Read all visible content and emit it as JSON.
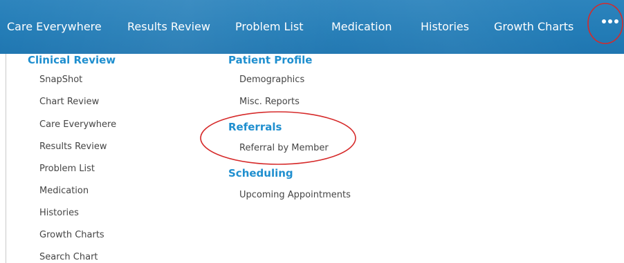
{
  "nav": {
    "items": [
      {
        "label": "Care Everywhere"
      },
      {
        "label": "Results Review"
      },
      {
        "label": "Problem List"
      },
      {
        "label": "Medication"
      },
      {
        "label": "Histories"
      },
      {
        "label": "Growth Charts"
      }
    ],
    "more_icon": "more-dots-icon"
  },
  "menu": {
    "clinical_review": {
      "heading": "Clinical Review",
      "items": [
        "SnapShot",
        "Chart Review",
        "Care Everywhere",
        "Results Review",
        "Problem List",
        "Medication",
        "Histories",
        "Growth Charts",
        "Search Chart"
      ]
    },
    "patient_profile": {
      "heading": "Patient Profile",
      "items": [
        "Demographics",
        "Misc. Reports"
      ]
    },
    "referrals": {
      "heading": "Referrals",
      "items": [
        "Referral by Member"
      ]
    },
    "scheduling": {
      "heading": "Scheduling",
      "items": [
        "Upcoming Appointments"
      ]
    }
  },
  "colors": {
    "nav_bar": "#237cb6",
    "heading": "#1f8fcf",
    "item_text": "#454545",
    "annotation_circle": "#d62a2a"
  }
}
